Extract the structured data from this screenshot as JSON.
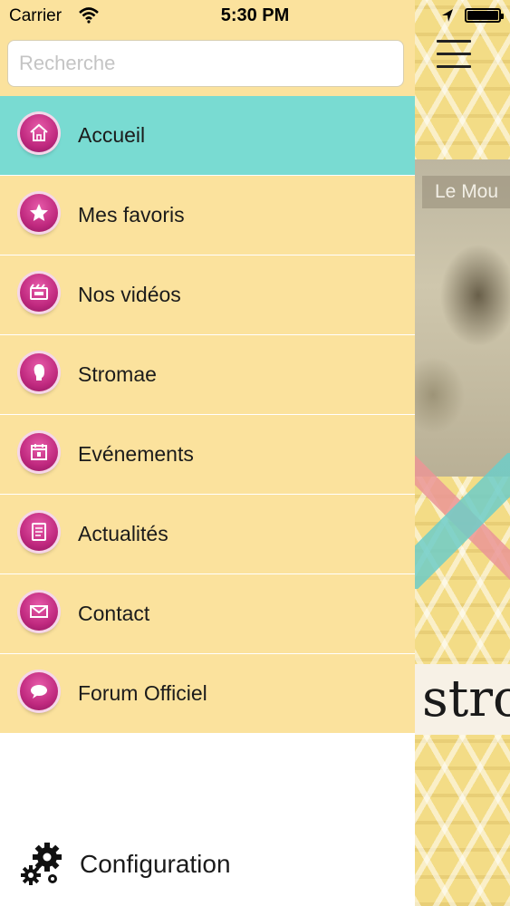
{
  "status_bar": {
    "carrier": "Carrier",
    "time": "5:30 PM"
  },
  "search": {
    "placeholder": "Recherche"
  },
  "menu": {
    "items": [
      {
        "label": "Accueil",
        "icon": "home-icon",
        "active": true
      },
      {
        "label": "Mes favoris",
        "icon": "star-icon",
        "active": false
      },
      {
        "label": "Nos vidéos",
        "icon": "video-icon",
        "active": false
      },
      {
        "label": "Stromae",
        "icon": "profile-icon",
        "active": false
      },
      {
        "label": "Evénements",
        "icon": "calendar-icon",
        "active": false
      },
      {
        "label": "Actualités",
        "icon": "news-icon",
        "active": false
      },
      {
        "label": "Contact",
        "icon": "mail-icon",
        "active": false
      },
      {
        "label": "Forum Officiel",
        "icon": "chat-icon",
        "active": false
      }
    ],
    "config_label": "Configuration"
  },
  "content_peek": {
    "photo_label": "Le Mou",
    "banner_text": "stro"
  },
  "colors": {
    "menu_bg": "#fbe29d",
    "active_bg": "#79dbd2",
    "icon_pink": "#c0297f"
  }
}
